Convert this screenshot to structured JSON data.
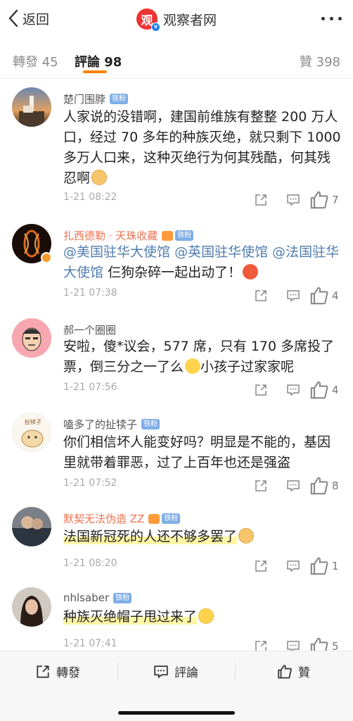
{
  "nav": {
    "back_label": "返回",
    "title": "观察者网",
    "logo_char": "观"
  },
  "tabs": {
    "reposts": "轉發 45",
    "comments": "評論 98",
    "likes": "贊 398"
  },
  "comments": [
    {
      "username": "楚门围脖",
      "badge": "铁粉",
      "text": "人家说的没错啊，建国前维族有整整 200 万人口，经过 70 多年的种族灭绝，就只剩下 1000 多万人口来，这种灭绝行为何其残酷，何其残忍啊",
      "time": "1-21 08:22",
      "likes": "7"
    },
    {
      "username": "扎西德勒 · 天珠收藏",
      "badge": "铁粉",
      "mentions": [
        "@美国驻华大使馆",
        "@英国驻华使馆",
        "@法国驻华大使馆"
      ],
      "text": "仨狗杂碎一起出动了！",
      "time": "1-21 07:38",
      "likes": "4"
    },
    {
      "username": "郝一个圈圈",
      "text_a": "安啦，傻*议会，577 席，只有 170 多席投了票，倒三分之一了么",
      "text_b": "小孩子过家家呢",
      "time": "1-21 07:56",
      "likes": "4"
    },
    {
      "username": "嗑多了的扯犊子",
      "badge": "铁粉",
      "avatar_text": "扯犊子",
      "text": "你们相信坏人能变好吗？明显是不能的，基因里就带着罪恶，过了上百年也还是强盗",
      "time": "1-21 07:52",
      "likes": "8"
    },
    {
      "username": "默契无法伪造 ZZ",
      "badge": "铁粉",
      "text": "法国新冠死的人还不够多罢了",
      "time": "1-21 08:20",
      "likes": "1"
    },
    {
      "username": "nhlsaber",
      "badge": "铁粉",
      "text": "种族灭绝帽子甩过来了",
      "time": "1-21 07:41",
      "likes": "5"
    }
  ],
  "bottom": {
    "repost": "轉發",
    "comment": "評論",
    "like": "贊"
  },
  "colors": {
    "accent": "#ff8200",
    "mention": "#507daf",
    "badge": "#7faee7",
    "highlight": "#fff6a6"
  }
}
